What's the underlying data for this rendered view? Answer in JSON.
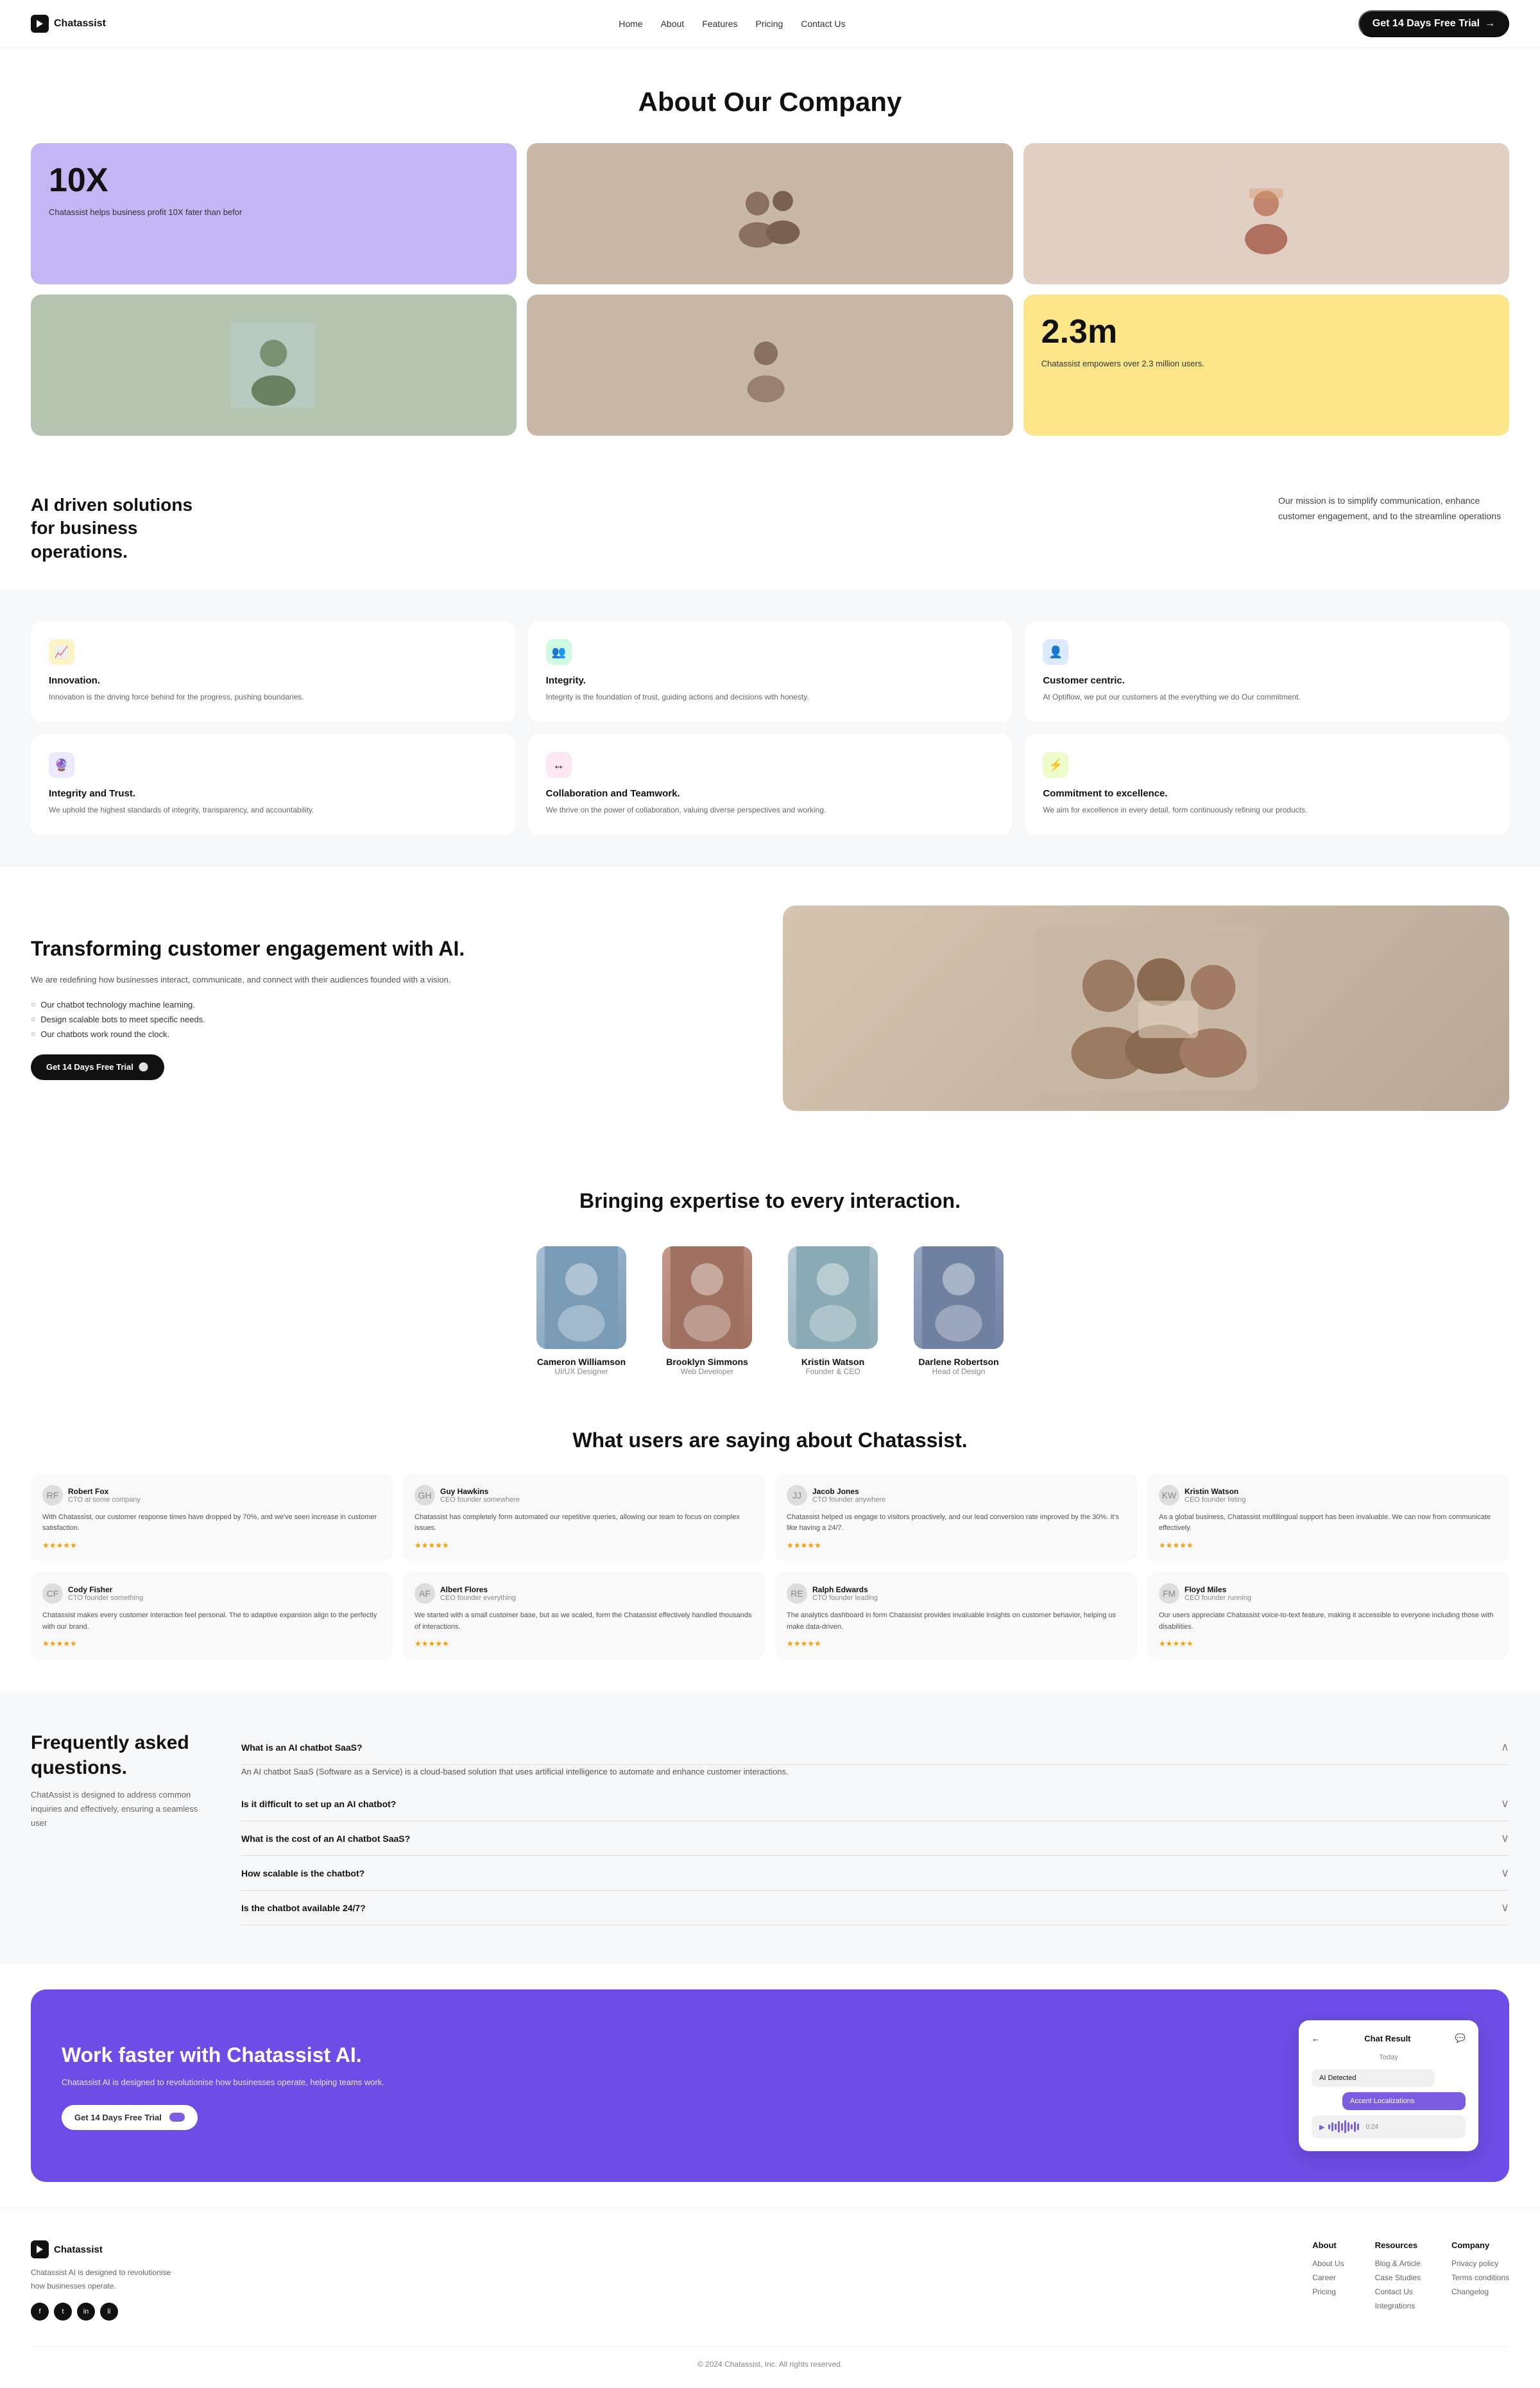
{
  "site": {
    "name": "Chatassist",
    "tagline": "Chatassist AI is designed to revolutionise how businesses operate."
  },
  "navbar": {
    "logo_text": "Chatassist",
    "links": [
      "Home",
      "About",
      "Features",
      "Pricing",
      "Contact Us"
    ],
    "cta_label": "Get 14 Days Free Trial"
  },
  "hero": {
    "title": "About Our Company"
  },
  "stats": {
    "multiplier": "10X",
    "multiplier_desc": "Chatassist helps business profit 10X fater than befor",
    "users": "2.3m",
    "users_desc": "Chatassist empowers over 2.3 million users."
  },
  "mission": {
    "heading": "AI driven solutions for business operations.",
    "description": "Our mission is to simplify communication, enhance customer engagement, and to the streamline operations"
  },
  "values": [
    {
      "icon": "📈",
      "icon_color": "yellow",
      "title": "Innovation.",
      "desc": "Innovation is the driving force behind for the progress, pushing boundaries."
    },
    {
      "icon": "👥",
      "icon_color": "green",
      "title": "Integrity.",
      "desc": "Integrity is the foundation of trust, guiding actions and decisions with honesty."
    },
    {
      "icon": "👤",
      "icon_color": "blue",
      "title": "Customer centric.",
      "desc": "At Optiflow, we put our customers at the everything we do Our commitment."
    },
    {
      "icon": "🔮",
      "icon_color": "purple",
      "title": "Integrity and Trust.",
      "desc": "We uphold the highest standards of integrity, transparency, and accountability."
    },
    {
      "icon": "↔",
      "icon_color": "pink",
      "title": "Collaboration and Teamwork.",
      "desc": "We thrive on the power of collaboration, valuing diverse perspectives and working."
    },
    {
      "icon": "⚡",
      "icon_color": "lime",
      "title": "Commitment to excellence.",
      "desc": "We aim for excellence in every detail, form continuously refining our products."
    }
  ],
  "transform": {
    "heading": "Transforming customer engagement with AI.",
    "desc": "We are redefining how businesses interact, communicate, and connect with their audiences founded with a vision.",
    "features": [
      "Our chatbot technology machine learning.",
      "Design scalable bots to meet specific needs.",
      "Our chatbots work round the clock."
    ],
    "cta": "Get 14 Days Free Trial"
  },
  "expertise": {
    "heading": "Bringing expertise to every interaction.",
    "team": [
      {
        "name": "Cameron Williamson",
        "role": "UI/UX Designer",
        "color": "avatar-cam"
      },
      {
        "name": "Brooklyn Simmons",
        "role": "Web Developer",
        "color": "avatar-brook"
      },
      {
        "name": "Kristin Watson",
        "role": "Founder & CEO",
        "color": "avatar-krist"
      },
      {
        "name": "Darlene Robertson",
        "role": "Head of Design",
        "color": "avatar-darl"
      }
    ]
  },
  "testimonials": {
    "heading": "What users are saying about Chatassist.",
    "items": [
      {
        "name": "Robert Fox",
        "role": "CTO at some company",
        "text": "With Chatassist, our customer response times have dropped by 70%, and we've seen increase in customer satisfaction.",
        "stars": 5
      },
      {
        "name": "Guy Hawkins",
        "role": "CEO founder somewhere",
        "text": "Chatassist has completely form automated our repetitive queries, allowing our team to focus on complex issues.",
        "stars": 5
      },
      {
        "name": "Jacob Jones",
        "role": "CTO founder anywhere",
        "text": "Chatassist helped us engage to visitors proactively, and our lead conversion rate improved by the 30%. It's like having a 24/7.",
        "stars": 5
      },
      {
        "name": "Kristin Watson",
        "role": "CEO founder listing",
        "text": "As a global business, Chatassist multilingual support has been invaluable. We can now from communicate effectively.",
        "stars": 5
      },
      {
        "name": "Cody Fisher",
        "role": "CTO founder something",
        "text": "Chatassist makes every customer interaction feel personal. The to adaptive expansion align to the perfectly with our brand.",
        "stars": 5
      },
      {
        "name": "Albert Flores",
        "role": "CEO founder everything",
        "text": "We started with a small customer base, but as we scaled, form the Chatassist effectively handled thousands of interactions.",
        "stars": 5
      },
      {
        "name": "Ralph Edwards",
        "role": "CTO founder leading",
        "text": "The analytics dashboard in form Chatassist provides invaluable insights on customer behavior, helping us make data-driven.",
        "stars": 5
      },
      {
        "name": "Floyd Miles",
        "role": "CEO founder running",
        "text": "Our users appreciate Chatassist voice-to-text feature, making it accessible to everyone including those with disabilities.",
        "stars": 5
      }
    ]
  },
  "faq": {
    "heading": "Frequently asked questions.",
    "desc": "ChatAssist is designed to address common inquiries and effectively, ensuring a seamless user",
    "items": [
      {
        "question": "What is an AI chatbot SaaS?",
        "answer": "An AI chatbot SaaS (Software as a Service) is a cloud-based solution that uses artificial intelligence to automate and enhance customer interactions.",
        "open": true
      },
      {
        "question": "Is it difficult to set up an AI chatbot?",
        "answer": "",
        "open": false
      },
      {
        "question": "What is the cost of an AI chatbot SaaS?",
        "answer": "",
        "open": false
      },
      {
        "question": "How scalable is the chatbot?",
        "answer": "",
        "open": false
      },
      {
        "question": "Is the chatbot available 24/7?",
        "answer": "",
        "open": false
      }
    ]
  },
  "cta_banner": {
    "heading": "Work faster with Chatassist AI.",
    "desc": "Chatassist AI is designed to revolutionise how businesses operate, helping teams work.",
    "cta_label": "Get 14 Days Free Trial",
    "chat_title": "Chat Result",
    "chat_today": "Today",
    "chat_ai_msg": "AI Detected",
    "chat_acc_msg": "Accent Localizations"
  },
  "footer": {
    "brand_desc": "Chatassist AI is designed to revolutionise how businesses operate.",
    "cols": [
      {
        "heading": "About",
        "links": [
          "About Us",
          "Career",
          "Pricing"
        ]
      },
      {
        "heading": "Resources",
        "links": [
          "Blog & Article",
          "Case Studies",
          "Contact Us",
          "Integrations"
        ]
      },
      {
        "heading": "Company",
        "links": [
          "Privacy policy",
          "Terms conditions",
          "Changelog"
        ]
      }
    ],
    "copyright": "© 2024 Chatassist, Inc. All rights reserved."
  }
}
